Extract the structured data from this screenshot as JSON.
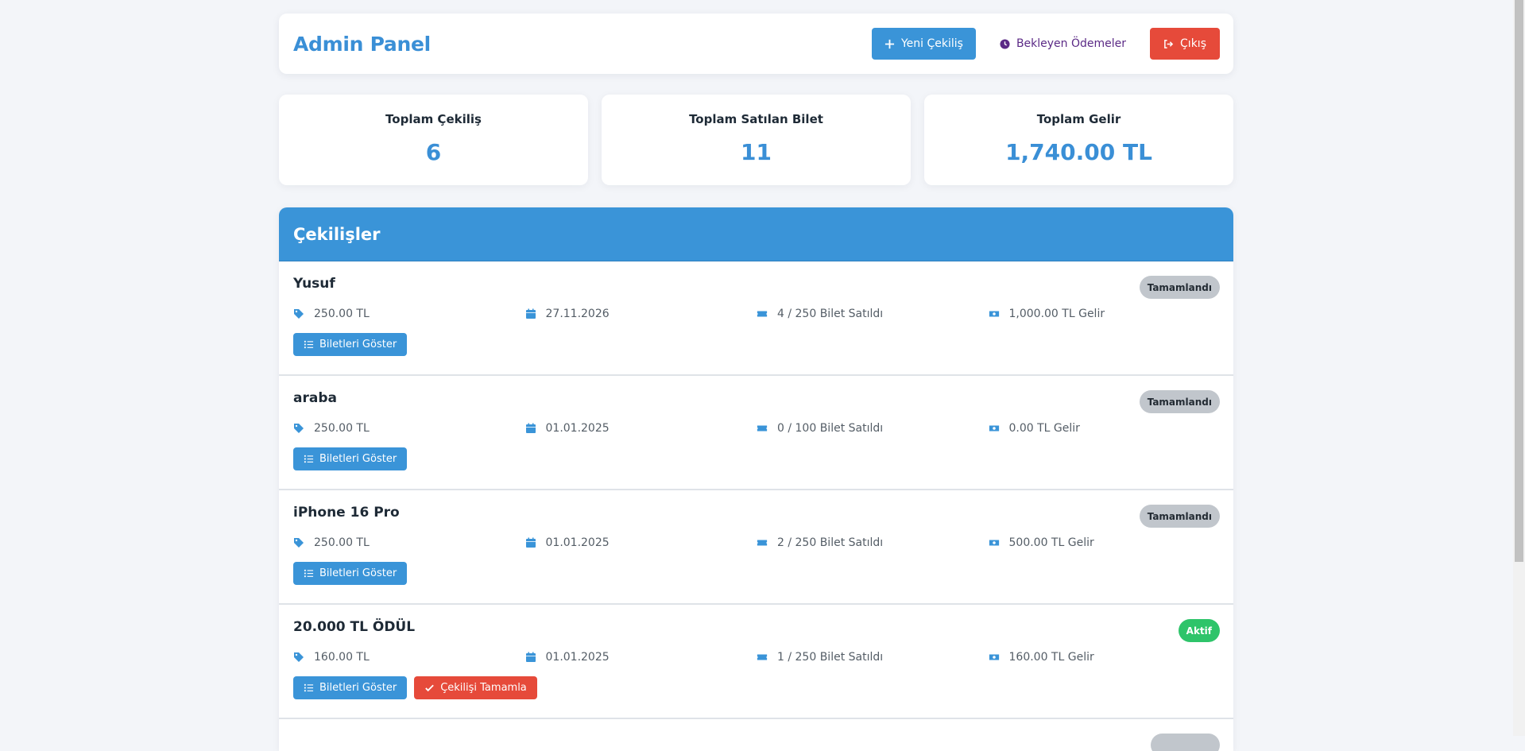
{
  "header": {
    "brand": "Admin Panel",
    "new_draw_label": "Yeni Çekiliş",
    "pending_label": "Bekleyen Ödemeler",
    "logout_label": "Çıkış"
  },
  "stats": [
    {
      "label": "Toplam Çekiliş",
      "value": "6"
    },
    {
      "label": "Toplam Satılan Bilet",
      "value": "11"
    },
    {
      "label": "Toplam Gelir",
      "value": "1,740.00 TL"
    }
  ],
  "draws_panel": {
    "title": "Çekilişler",
    "show_tickets_label": "Biletleri Göster",
    "complete_label": "Çekilişi Tamamla",
    "items": [
      {
        "title": "Yusuf",
        "status": "Tamamlandı",
        "price": "250.00 TL",
        "date": "27.11.2026",
        "tickets": "4 / 250 Bilet Satıldı",
        "revenue": "1,000.00 TL Gelir"
      },
      {
        "title": "araba",
        "status": "Tamamlandı",
        "price": "250.00 TL",
        "date": "01.01.2025",
        "tickets": "0 / 100 Bilet Satıldı",
        "revenue": "0.00 TL Gelir"
      },
      {
        "title": "iPhone 16 Pro",
        "status": "Tamamlandı",
        "price": "250.00 TL",
        "date": "01.01.2025",
        "tickets": "2 / 250 Bilet Satıldı",
        "revenue": "500.00 TL Gelir"
      },
      {
        "title": "20.000 TL ÖDÜL",
        "status": "Aktif",
        "price": "160.00 TL",
        "date": "01.01.2025",
        "tickets": "1 / 250 Bilet Satıldı",
        "revenue": "160.00 TL Gelir"
      }
    ]
  },
  "colors": {
    "accent": "#3a94d8",
    "danger": "#e64a3a",
    "success": "#2ec46a",
    "completed_badge": "#c1c6cc"
  },
  "icons": {
    "new_draw": "plus-icon",
    "pending": "clock-icon",
    "logout": "sign-out-icon",
    "price": "tag-icon",
    "date": "calendar-icon",
    "tickets": "ticket-icon",
    "revenue": "money-icon",
    "show_tickets": "list-icon",
    "complete": "check-icon"
  }
}
